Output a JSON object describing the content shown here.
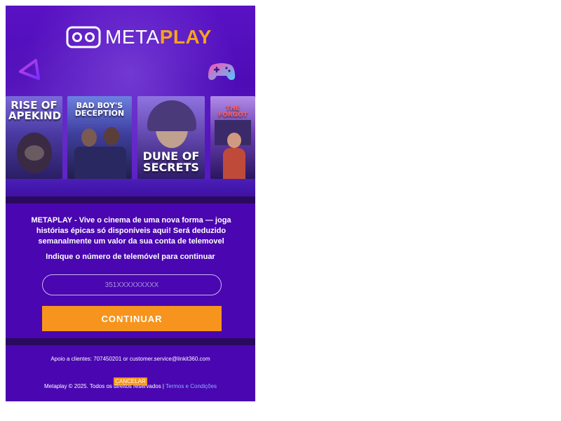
{
  "header": {
    "logo_text_light": "META",
    "logo_text_bold": "PLAY",
    "logo_icon": "vr-headset-icon",
    "deco_left_icon": "play-triangle-icon",
    "deco_right_icon": "gamepad-icon"
  },
  "posters": [
    {
      "title_line1": "RISE OF",
      "title_line2": "APEKIND"
    },
    {
      "title_line1": "BAD BOY'S",
      "title_line2": "DECEPTION"
    },
    {
      "title_line1": "DUNE OF",
      "title_line2": "SECRETS"
    },
    {
      "title_line1": "THE FORGOT",
      "title_line2": ""
    }
  ],
  "main": {
    "description": "METAPLAY - Vive o cinema de uma nova forma — joga histórias épicas só disponíveis aqui! Será deduzido semanalmente um valor da sua conta de telemovel",
    "prompt": "Indique o número de telemóvel para continuar",
    "phone_placeholder": "351XXXXXXXXX",
    "continue_label": "CONTINUAR"
  },
  "footer": {
    "support": "Apoio a clientes: 707450201 or customer.service@linkit360.com",
    "cancel_label": "CANCELAR",
    "copyright": "Metaplay © 2025. Todos os direitos reservados |",
    "terms_label": "Termos e Condições"
  },
  "colors": {
    "background": "#4a06b0",
    "accent": "#f7941d",
    "link": "#8fb0ff"
  }
}
